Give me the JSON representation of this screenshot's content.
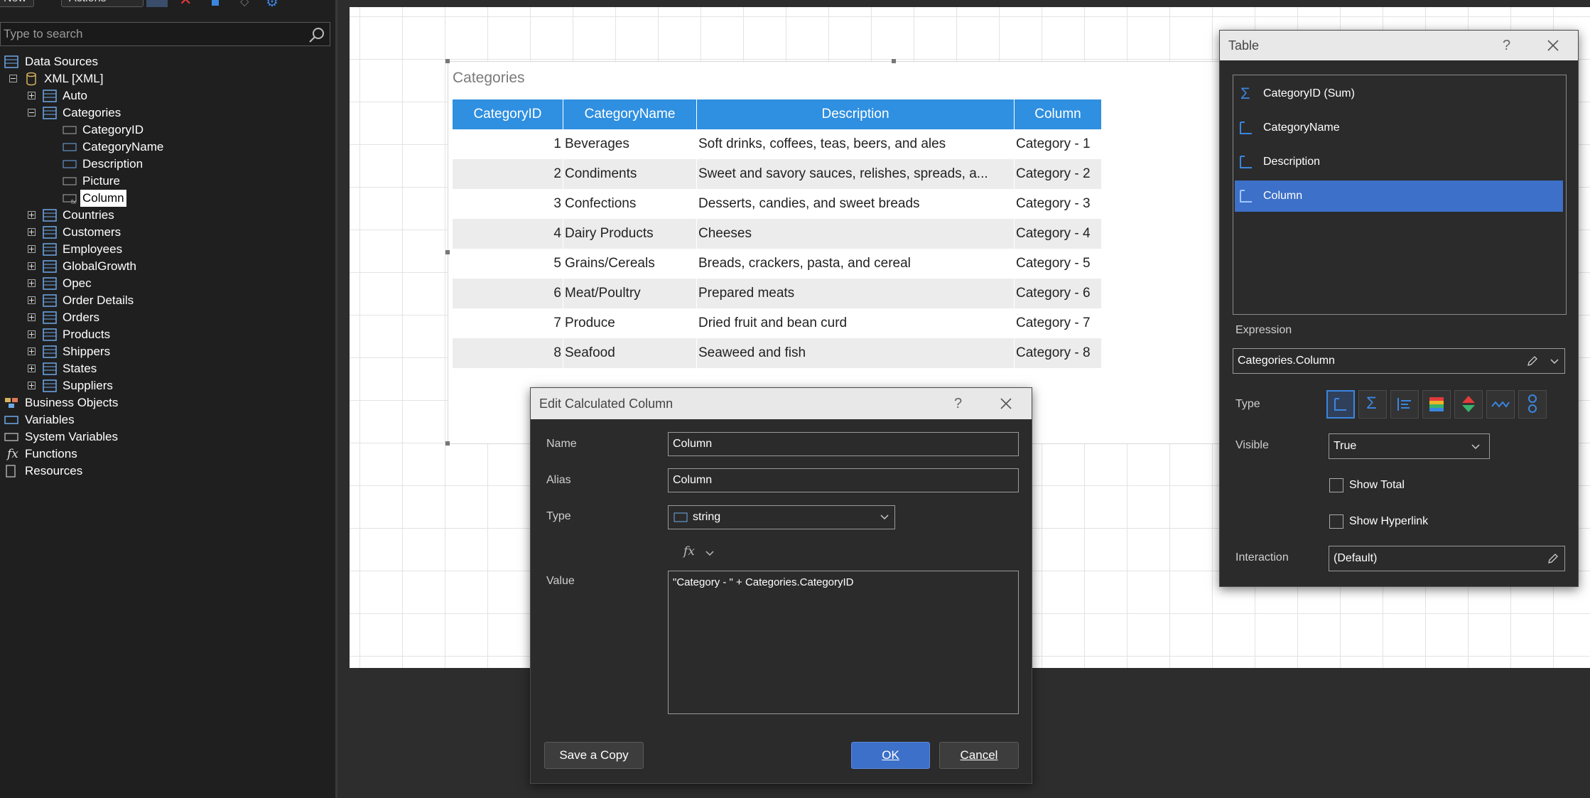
{
  "toolbar": {
    "new_label": "New",
    "actions_label": "Actions"
  },
  "search": {
    "placeholder": "Type to search"
  },
  "tree": {
    "data_sources": "Data Sources",
    "xml": "XML [XML]",
    "auto": "Auto",
    "categories": "Categories",
    "fields": [
      "CategoryID",
      "CategoryName",
      "Description",
      "Picture",
      "Column"
    ],
    "tables": [
      "Countries",
      "Customers",
      "Employees",
      "GlobalGrowth",
      "Opec",
      "Order Details",
      "Orders",
      "Products",
      "Shippers",
      "States",
      "Suppliers"
    ],
    "business_objects": "Business Objects",
    "variables": "Variables",
    "system_variables": "System Variables",
    "functions": "Functions",
    "resources": "Resources"
  },
  "report": {
    "title": "Categories",
    "headers": [
      "CategoryID",
      "CategoryName",
      "Description",
      "Column"
    ],
    "rows": [
      [
        "1",
        "Beverages",
        "Soft drinks, coffees, teas, beers, and ales",
        "Category - 1"
      ],
      [
        "2",
        "Condiments",
        "Sweet and savory sauces, relishes, spreads, a...",
        "Category - 2"
      ],
      [
        "3",
        "Confections",
        "Desserts, candies, and sweet breads",
        "Category - 3"
      ],
      [
        "4",
        "Dairy Products",
        "Cheeses",
        "Category - 4"
      ],
      [
        "5",
        "Grains/Cereals",
        "Breads, crackers, pasta, and cereal",
        "Category - 5"
      ],
      [
        "6",
        "Meat/Poultry",
        "Prepared meats",
        "Category - 6"
      ],
      [
        "7",
        "Produce",
        "Dried fruit and bean curd",
        "Category - 7"
      ],
      [
        "8",
        "Seafood",
        "Seaweed and fish",
        "Category - 8"
      ]
    ]
  },
  "calc_dialog": {
    "title": "Edit Calculated Column",
    "help": "?",
    "name_label": "Name",
    "name_value": "Column",
    "alias_label": "Alias",
    "alias_value": "Column",
    "type_label": "Type",
    "type_value": "string",
    "fx": "fx",
    "value_label": "Value",
    "value_text": "\"Category - \" + Categories.CategoryID",
    "save_copy": "Save a Copy",
    "ok": "OK",
    "cancel": "Cancel"
  },
  "table_panel": {
    "title": "Table",
    "help": "?",
    "columns": [
      "CategoryID (Sum)",
      "CategoryName",
      "Description",
      "Column"
    ],
    "expression_label": "Expression",
    "expression_value": "Categories.Column",
    "type_label": "Type",
    "visible_label": "Visible",
    "visible_value": "True",
    "show_total": "Show Total",
    "show_hyperlink": "Show Hyperlink",
    "interaction_label": "Interaction",
    "interaction_value": "(Default)"
  },
  "colors": {
    "accent": "#3d70c8",
    "header_blue": "#2f8fe0",
    "panel_bg": "#2b2b2b",
    "sidebar_bg": "#1f1f1f"
  }
}
